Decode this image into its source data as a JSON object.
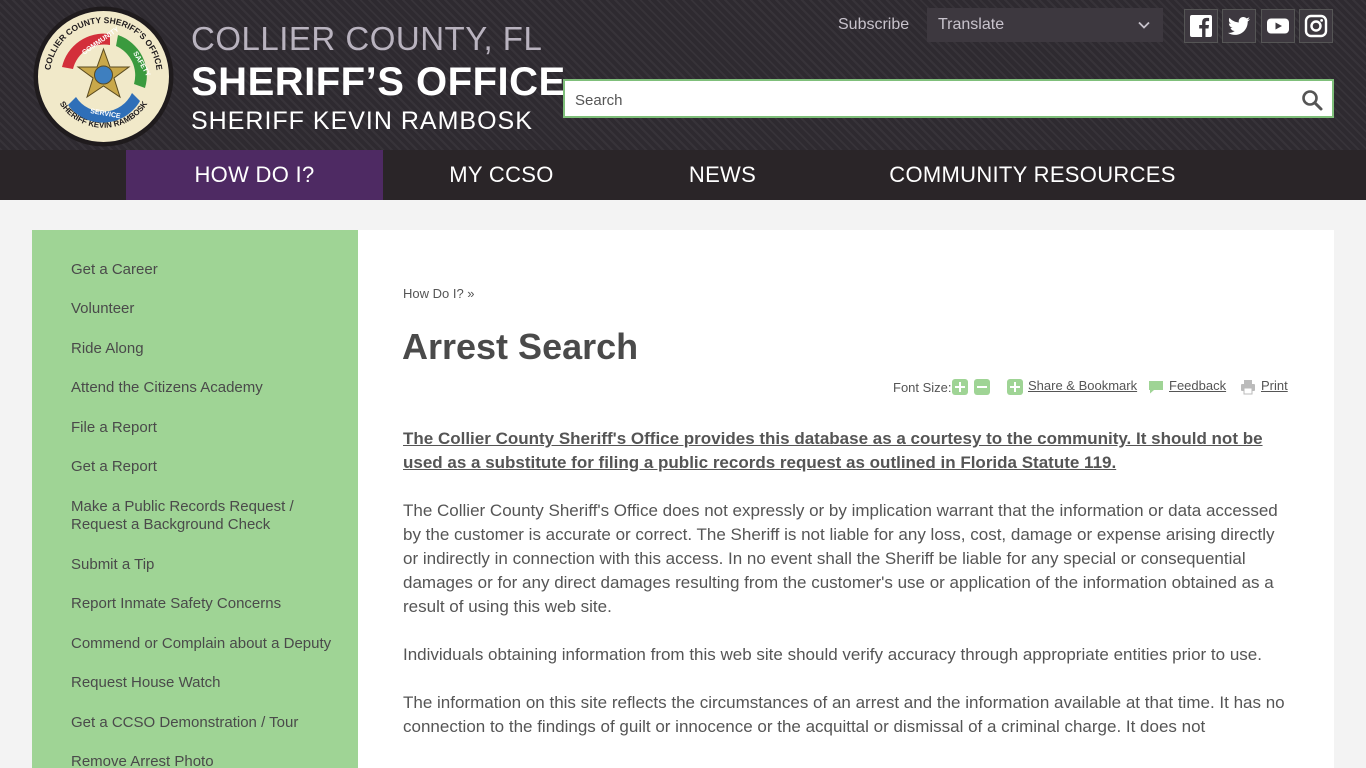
{
  "header": {
    "seal_texts": [
      "COLLIER COUNTY SHERIFF'S OFFICE",
      "COMMUNITY",
      "SAFETY",
      "SERVICE",
      "SHERIFF KEVIN RAMBOSK"
    ],
    "brand_line1": "COLLIER COUNTY, FL",
    "brand_line2": "SHERIFF’S OFFICE",
    "brand_line3": "SHERIFF KEVIN RAMBOSK",
    "subscribe": "Subscribe",
    "translate": "Translate",
    "search_placeholder": "Search",
    "social_icons": [
      "facebook-icon",
      "twitter-icon",
      "youtube-icon",
      "instagram-icon"
    ]
  },
  "nav": {
    "items": [
      {
        "label": "HOW DO I?",
        "active": true
      },
      {
        "label": "MY CCSO",
        "active": false
      },
      {
        "label": "NEWS",
        "active": false
      },
      {
        "label": "COMMUNITY RESOURCES",
        "active": false
      }
    ]
  },
  "sidebar": {
    "items": [
      "Get a Career",
      "Volunteer",
      "Ride Along",
      "Attend the Citizens Academy",
      "File a Report",
      "Get a Report",
      "Make a Public Records Request / Request a Background Check",
      "Submit a Tip",
      "Report Inmate Safety Concerns",
      "Commend or Complain about a Deputy",
      "Request House Watch",
      "Get a CCSO Demonstration / Tour",
      "Remove Arrest Photo"
    ]
  },
  "main": {
    "breadcrumb": "How Do I? »",
    "title": "Arrest Search",
    "tools": {
      "font_size": "Font Size:",
      "share": "Share & Bookmark",
      "feedback": "Feedback",
      "print": "Print"
    },
    "lead": "The Collier County Sheriff's Office provides this database as a courtesy to the community. It should not be used as a substitute for filing a public records request as outlined in Florida Statute 119.",
    "paragraphs": [
      "The Collier County Sheriff's Office does not expressly or by implication warrant that the information or data accessed by the customer is accurate or correct. The Sheriff is not liable for any loss, cost, damage or expense arising directly or indirectly in connection with this access. In no event shall the Sheriff be liable for any special or consequential damages or for any direct damages resulting from the customer's use or application of the information obtained as a result of using this web site.",
      "Individuals obtaining information from this web site should verify accuracy through appropriate entities prior to use.",
      "The information on this site reflects the circumstances of an arrest and the information available at that time. It has no connection to the findings of guilt or innocence or the acquittal or dismissal of a criminal charge. It does not"
    ]
  },
  "colors": {
    "header_bg": "#2e2a30",
    "nav_bg": "#2a2528",
    "nav_active": "#4e2a63",
    "sidebar_bg": "#9fd495",
    "search_border": "#7fbf7a"
  }
}
